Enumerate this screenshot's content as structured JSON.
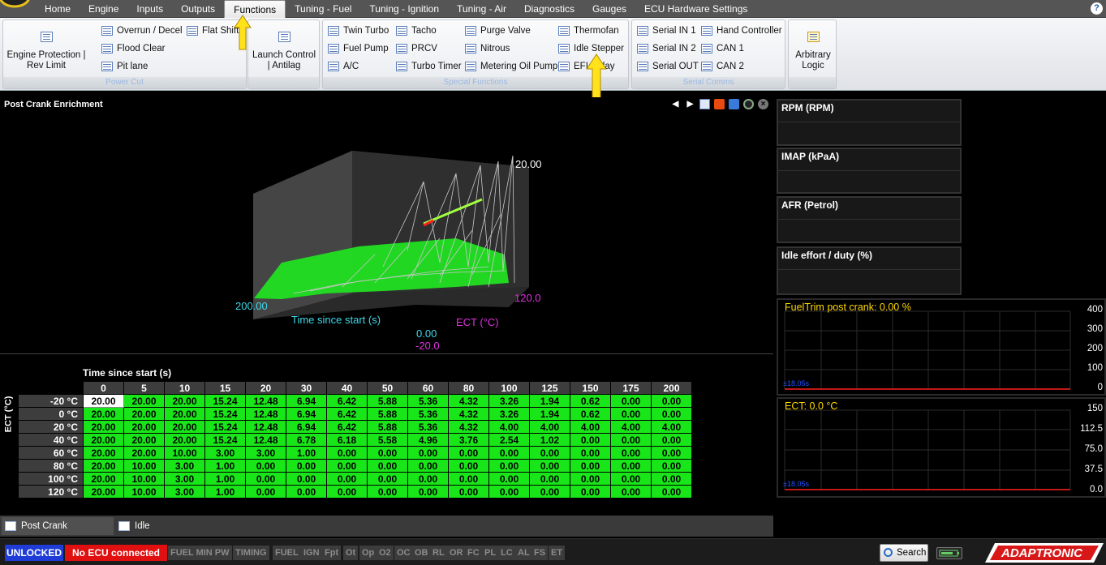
{
  "menu": {
    "items": [
      "Home",
      "Engine",
      "Inputs",
      "Outputs",
      "Functions",
      "Tuning - Fuel",
      "Tuning - Ignition",
      "Tuning - Air",
      "Diagnostics",
      "Gauges",
      "ECU Hardware Settings"
    ],
    "active": "Functions",
    "help": "?"
  },
  "ribbon": {
    "power_cut": {
      "caption": "Power Cut",
      "engine_protection": "Engine Protection | Rev Limit",
      "overrun": "Overrun / Decel",
      "flood_clear": "Flood Clear",
      "pit_lane": "Pit lane",
      "flat_shift": "Flat Shift"
    },
    "launch": {
      "label": "Launch Control | Antilag"
    },
    "special": {
      "caption": "Special Functions",
      "twin_turbo": "Twin Turbo",
      "fuel_pump": "Fuel Pump",
      "ac": "A/C",
      "tacho": "Tacho",
      "prcv": "PRCV",
      "turbo_timer": "Turbo Timer",
      "purge_valve": "Purge Valve",
      "nitrous": "Nitrous",
      "metering_oil_pump": "Metering Oil Pump",
      "thermofan": "Thermofan",
      "idle_stepper": "Idle Stepper",
      "efi_relay": "EFI Relay"
    },
    "serial": {
      "caption": "Serial Comms",
      "serial_in_1": "Serial IN 1",
      "serial_in_2": "Serial IN 2",
      "serial_out": "Serial OUT",
      "hand_controller": "Hand Controller",
      "can1": "CAN 1",
      "can2": "CAN 2"
    },
    "arbitrary": {
      "label": "Arbitrary Logic"
    }
  },
  "panel": {
    "title": "Post Crank Enrichment",
    "graph": {
      "z_max_label": "20.00",
      "x_max_label": "200.00",
      "x_axis_label": "Time since start (s)",
      "x_min_label": "0.00",
      "y_axis_label": "ECT (°C)",
      "y_max_label": "120.0",
      "y_min_label": "-20.0"
    }
  },
  "table": {
    "title": "Time since start (s)",
    "row_axis_label": "ECT (°C)",
    "columns": [
      "0",
      "5",
      "10",
      "15",
      "20",
      "30",
      "40",
      "50",
      "60",
      "80",
      "100",
      "125",
      "150",
      "175",
      "200"
    ],
    "rows": [
      {
        "label": "-20 °C",
        "values": [
          "20.00",
          "20.00",
          "20.00",
          "15.24",
          "12.48",
          "6.94",
          "6.42",
          "5.88",
          "5.36",
          "4.32",
          "3.26",
          "1.94",
          "0.62",
          "0.00",
          "0.00"
        ]
      },
      {
        "label": "0 °C",
        "values": [
          "20.00",
          "20.00",
          "20.00",
          "15.24",
          "12.48",
          "6.94",
          "6.42",
          "5.88",
          "5.36",
          "4.32",
          "3.26",
          "1.94",
          "0.62",
          "0.00",
          "0.00"
        ]
      },
      {
        "label": "20 °C",
        "values": [
          "20.00",
          "20.00",
          "20.00",
          "15.24",
          "12.48",
          "6.94",
          "6.42",
          "5.88",
          "5.36",
          "4.32",
          "4.00",
          "4.00",
          "4.00",
          "4.00",
          "4.00"
        ]
      },
      {
        "label": "40 °C",
        "values": [
          "20.00",
          "20.00",
          "20.00",
          "15.24",
          "12.48",
          "6.78",
          "6.18",
          "5.58",
          "4.96",
          "3.76",
          "2.54",
          "1.02",
          "0.00",
          "0.00",
          "0.00"
        ]
      },
      {
        "label": "60 °C",
        "values": [
          "20.00",
          "20.00",
          "10.00",
          "3.00",
          "3.00",
          "1.00",
          "0.00",
          "0.00",
          "0.00",
          "0.00",
          "0.00",
          "0.00",
          "0.00",
          "0.00",
          "0.00"
        ]
      },
      {
        "label": "80 °C",
        "values": [
          "20.00",
          "10.00",
          "3.00",
          "1.00",
          "0.00",
          "0.00",
          "0.00",
          "0.00",
          "0.00",
          "0.00",
          "0.00",
          "0.00",
          "0.00",
          "0.00",
          "0.00"
        ]
      },
      {
        "label": "100 °C",
        "values": [
          "20.00",
          "10.00",
          "3.00",
          "1.00",
          "0.00",
          "0.00",
          "0.00",
          "0.00",
          "0.00",
          "0.00",
          "0.00",
          "0.00",
          "0.00",
          "0.00",
          "0.00"
        ]
      },
      {
        "label": "120 °C",
        "values": [
          "20.00",
          "10.00",
          "3.00",
          "1.00",
          "0.00",
          "0.00",
          "0.00",
          "0.00",
          "0.00",
          "0.00",
          "0.00",
          "0.00",
          "0.00",
          "0.00",
          "0.00"
        ]
      }
    ],
    "selected_cell": {
      "row": 0,
      "col": 0
    }
  },
  "bottom_tabs": [
    "Post Crank Enrichment",
    "Idle"
  ],
  "gauges": [
    "RPM (RPM)",
    "IMAP  (kPaA)",
    "AFR (Petrol)",
    "Idle effort / duty (%)"
  ],
  "trends": [
    {
      "title": "FuelTrim post crank:  0.00 %",
      "yticks": [
        "400",
        "300",
        "200",
        "100",
        "0"
      ],
      "scale": "±18.05s"
    },
    {
      "title": "ECT:  0.0 °C",
      "yticks": [
        "150",
        "112.5",
        "75.0",
        "37.5",
        "0.0"
      ],
      "scale": "±18.05s"
    }
  ],
  "status": {
    "lock": "UNLOCKED",
    "connection": "No ECU connected",
    "flags": [
      "FUEL MIN PW",
      "TIMING",
      "FUEL",
      "IGN",
      "Fpt",
      "Ot",
      "Op",
      "O2",
      "OC",
      "OB",
      "RL",
      "OR",
      "FC",
      "PL",
      "LC",
      "AL",
      "FS",
      "ET"
    ],
    "search": "Search",
    "brand": "ADAPTRONIC"
  },
  "colors": {
    "cell_green": "#19e619",
    "lock_blue": "#1f3dd6",
    "conn_red": "#e01010",
    "trace_red": "#ff2020",
    "label_cyan": "#3fd8e8",
    "label_magenta": "#e030e0",
    "trend_yellow": "#ffd800"
  },
  "icons": {
    "help": "question-icon",
    "search": "magnifier-icon",
    "battery": "battery-icon"
  }
}
